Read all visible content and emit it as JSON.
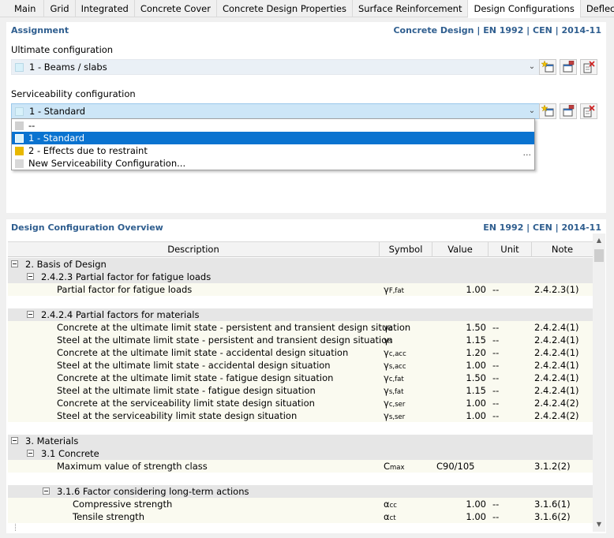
{
  "tabs": [
    "Main",
    "Grid",
    "Integrated",
    "Concrete Cover",
    "Concrete Design Properties",
    "Surface Reinforcement",
    "Design Configurations",
    "Deflection"
  ],
  "active_tab": "Design Configurations",
  "assignment": {
    "title": "Assignment",
    "standard": "Concrete Design | EN 1992 | CEN | 2014-11",
    "ultimate_label": "Ultimate configuration",
    "ultimate_value": "1 - Beams / slabs",
    "serviceability_label": "Serviceability configuration",
    "serviceability_value": "1 - Standard",
    "dropdown_items": [
      {
        "label": "--",
        "color": "#d0d0d0"
      },
      {
        "label": "1 - Standard",
        "color": "#d8f1fa"
      },
      {
        "label": "2 - Effects due to restraint",
        "color": "#e8b800"
      },
      {
        "label": "New Serviceability Configuration...",
        "color": "#d8d8d8"
      }
    ],
    "dropdown_more": "..."
  },
  "overview": {
    "title": "Design Configuration Overview",
    "standard": "EN 1992 | CEN | 2014-11",
    "columns": {
      "description": "Description",
      "symbol": "Symbol",
      "value": "Value",
      "unit": "Unit",
      "note": "Note"
    },
    "groups": {
      "g1": "2. Basis of Design",
      "g11": "2.4.2.3 Partial factor for fatigue loads",
      "g12": "2.4.2.4 Partial factors for materials",
      "g2": "3. Materials",
      "g21": "3.1 Concrete",
      "g211": "3.1.6 Factor considering long-term actions"
    },
    "rows": [
      {
        "desc": "Partial factor for fatigue loads",
        "sym": "γ",
        "sub": "F,fat",
        "val": "1.00",
        "unit": "--",
        "note": "2.4.2.3(1)"
      },
      {
        "desc": "Concrete at the ultimate limit state - persistent and transient design situation",
        "sym": "γ",
        "sub": "c",
        "val": "1.50",
        "unit": "--",
        "note": "2.4.2.4(1)"
      },
      {
        "desc": "Steel at the ultimate limit state - persistent and transient design situation",
        "sym": "γ",
        "sub": "s",
        "val": "1.15",
        "unit": "--",
        "note": "2.4.2.4(1)"
      },
      {
        "desc": "Concrete at the ultimate limit state - accidental design situation",
        "sym": "γ",
        "sub": "c,acc",
        "val": "1.20",
        "unit": "--",
        "note": "2.4.2.4(1)"
      },
      {
        "desc": "Steel at the ultimate limit state - accidental design situation",
        "sym": "γ",
        "sub": "s,acc",
        "val": "1.00",
        "unit": "--",
        "note": "2.4.2.4(1)"
      },
      {
        "desc": "Concrete at the ultimate limit state - fatigue design situation",
        "sym": "γ",
        "sub": "c,fat",
        "val": "1.50",
        "unit": "--",
        "note": "2.4.2.4(1)"
      },
      {
        "desc": "Steel at the ultimate limit state - fatigue design situation",
        "sym": "γ",
        "sub": "s,fat",
        "val": "1.15",
        "unit": "--",
        "note": "2.4.2.4(1)"
      },
      {
        "desc": "Concrete at the serviceability limit state design situation",
        "sym": "γ",
        "sub": "c,ser",
        "val": "1.00",
        "unit": "--",
        "note": "2.4.2.4(2)"
      },
      {
        "desc": "Steel at the serviceability limit state design situation",
        "sym": "γ",
        "sub": "s,ser",
        "val": "1.00",
        "unit": "--",
        "note": "2.4.2.4(2)"
      },
      {
        "desc": "Maximum value of strength class",
        "sym": "C",
        "sub": "max",
        "val": "C90/105",
        "unit": "",
        "note": "3.1.2(2)"
      },
      {
        "desc": "Compressive strength",
        "sym": "α",
        "sub": "cc",
        "val": "1.00",
        "unit": "--",
        "note": "3.1.6(1)"
      },
      {
        "desc": "Tensile strength",
        "sym": "α",
        "sub": "ct",
        "val": "1.00",
        "unit": "--",
        "note": "3.1.6(2)"
      }
    ]
  },
  "icons": {
    "new": "new-config-icon",
    "edit": "edit-config-icon",
    "delete": "delete-config-icon"
  }
}
